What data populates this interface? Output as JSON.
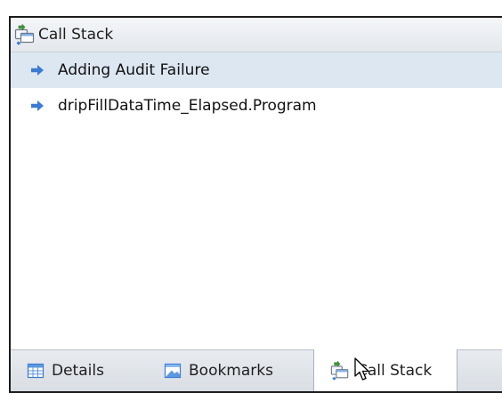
{
  "panel": {
    "title": "Call Stack",
    "title_icon": "call-stack-icon"
  },
  "call_stack": {
    "frames": [
      {
        "label": "Adding Audit Failure",
        "icon": "arrow-right-icon",
        "selected": true
      },
      {
        "label": "dripFillDataTime_Elapsed.Program",
        "icon": "arrow-right-icon",
        "selected": false
      }
    ]
  },
  "tabs": [
    {
      "label": "Details",
      "icon": "table-icon",
      "active": false
    },
    {
      "label": "Bookmarks",
      "icon": "bookmark-icon",
      "active": false
    },
    {
      "label": "Call Stack",
      "icon": "call-stack-icon",
      "active": true
    }
  ],
  "colors": {
    "selected_row": "#dde7f2",
    "arrow_icon": "#3b7bd4",
    "panel_border": "#1b1b1b"
  }
}
